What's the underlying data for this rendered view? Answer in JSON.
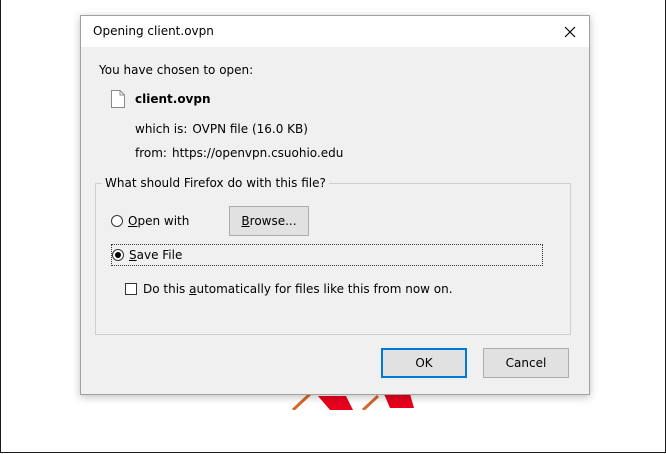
{
  "dialog": {
    "title": "Opening client.ovpn",
    "intro": "You have chosen to open:",
    "file_name": "client.ovpn",
    "which_is_label": "which is:",
    "which_is_value": "OVPN file (16.0 KB)",
    "from_label": "from:",
    "from_value": "https://openvpn.csuohio.edu",
    "group_legend": "What should Firefox do with this file?",
    "open_with": {
      "prefix": "",
      "accel": "O",
      "rest": "pen with"
    },
    "browse": {
      "accel": "B",
      "rest": "rowse..."
    },
    "save_file": {
      "accel": "S",
      "rest": "ave File"
    },
    "auto": {
      "before": "Do this ",
      "accel": "a",
      "after": "utomatically for files like this from now on."
    },
    "ok_label": "OK",
    "cancel_label": "Cancel",
    "selected_option": "save-file",
    "auto_checked": false
  },
  "colors": {
    "dialog_bg": "#f0f0f0",
    "titlebar_bg": "#ffffff",
    "default_button_border": "#0078d7",
    "backdrop_accent": "#e8001c"
  },
  "icons": {
    "close": "close-icon",
    "file": "document-icon"
  }
}
